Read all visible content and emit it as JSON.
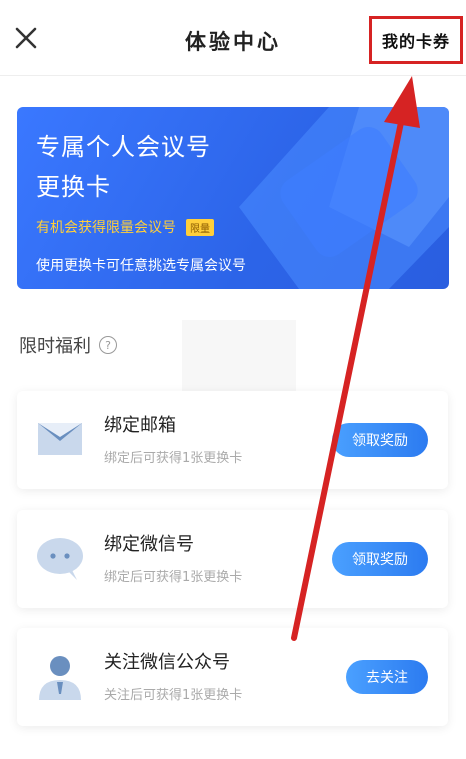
{
  "header": {
    "title": "体验中心",
    "my_cards_label": "我的卡券"
  },
  "hero": {
    "title_line1": "专属个人会议号",
    "title_line2": "更换卡",
    "subtitle": "有机会获得限量会议号",
    "limited_tag": "限量",
    "description": "使用更换卡可任意挑选专属会议号"
  },
  "section": {
    "title": "限时福利",
    "help_glyph": "?"
  },
  "tasks": [
    {
      "title": "绑定邮箱",
      "desc": "绑定后可获得1张更换卡",
      "button": "领取奖励",
      "icon": "envelope-icon"
    },
    {
      "title": "绑定微信号",
      "desc": "绑定后可获得1张更换卡",
      "button": "领取奖励",
      "icon": "chat-bubble-icon"
    },
    {
      "title": "关注微信公众号",
      "desc": "关注后可获得1张更换卡",
      "button": "去关注",
      "icon": "person-icon"
    }
  ],
  "colors": {
    "accent": "#2c7bf0",
    "hero_bg": "#3a78ff",
    "highlight": "#ffcf3a",
    "annotation": "#d62323"
  }
}
